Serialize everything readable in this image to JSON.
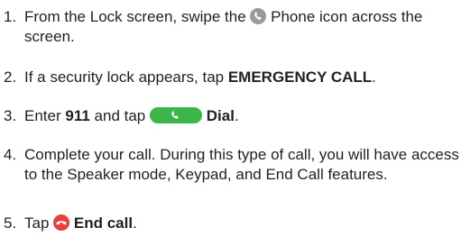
{
  "steps": [
    {
      "number": "1.",
      "text_before": "From the Lock screen, swipe the",
      "icon": "phone-icon",
      "text_after": "Phone icon across the screen."
    },
    {
      "number": "2.",
      "text_before": "If a security lock appears, tap",
      "bold": "EMERGENCY CALL",
      "text_after": "."
    },
    {
      "number": "3.",
      "text_before": "Enter",
      "bold1": "911",
      "text_mid": "and tap",
      "icon": "dial-phone-icon",
      "bold2": "Dial",
      "text_after": "."
    },
    {
      "number": "4.",
      "text": "Complete your call. During this type of call, you will have access to the Speaker mode, Keypad, and End Call features."
    },
    {
      "number": "5.",
      "text_before": "Tap",
      "icon": "end-call-icon",
      "bold": "End call",
      "text_after": "."
    }
  ],
  "colors": {
    "text": "#231f20",
    "phone_icon": "#9a9a9a",
    "dial_button": "#3cb54a",
    "end_call_button": "#e8403c"
  }
}
